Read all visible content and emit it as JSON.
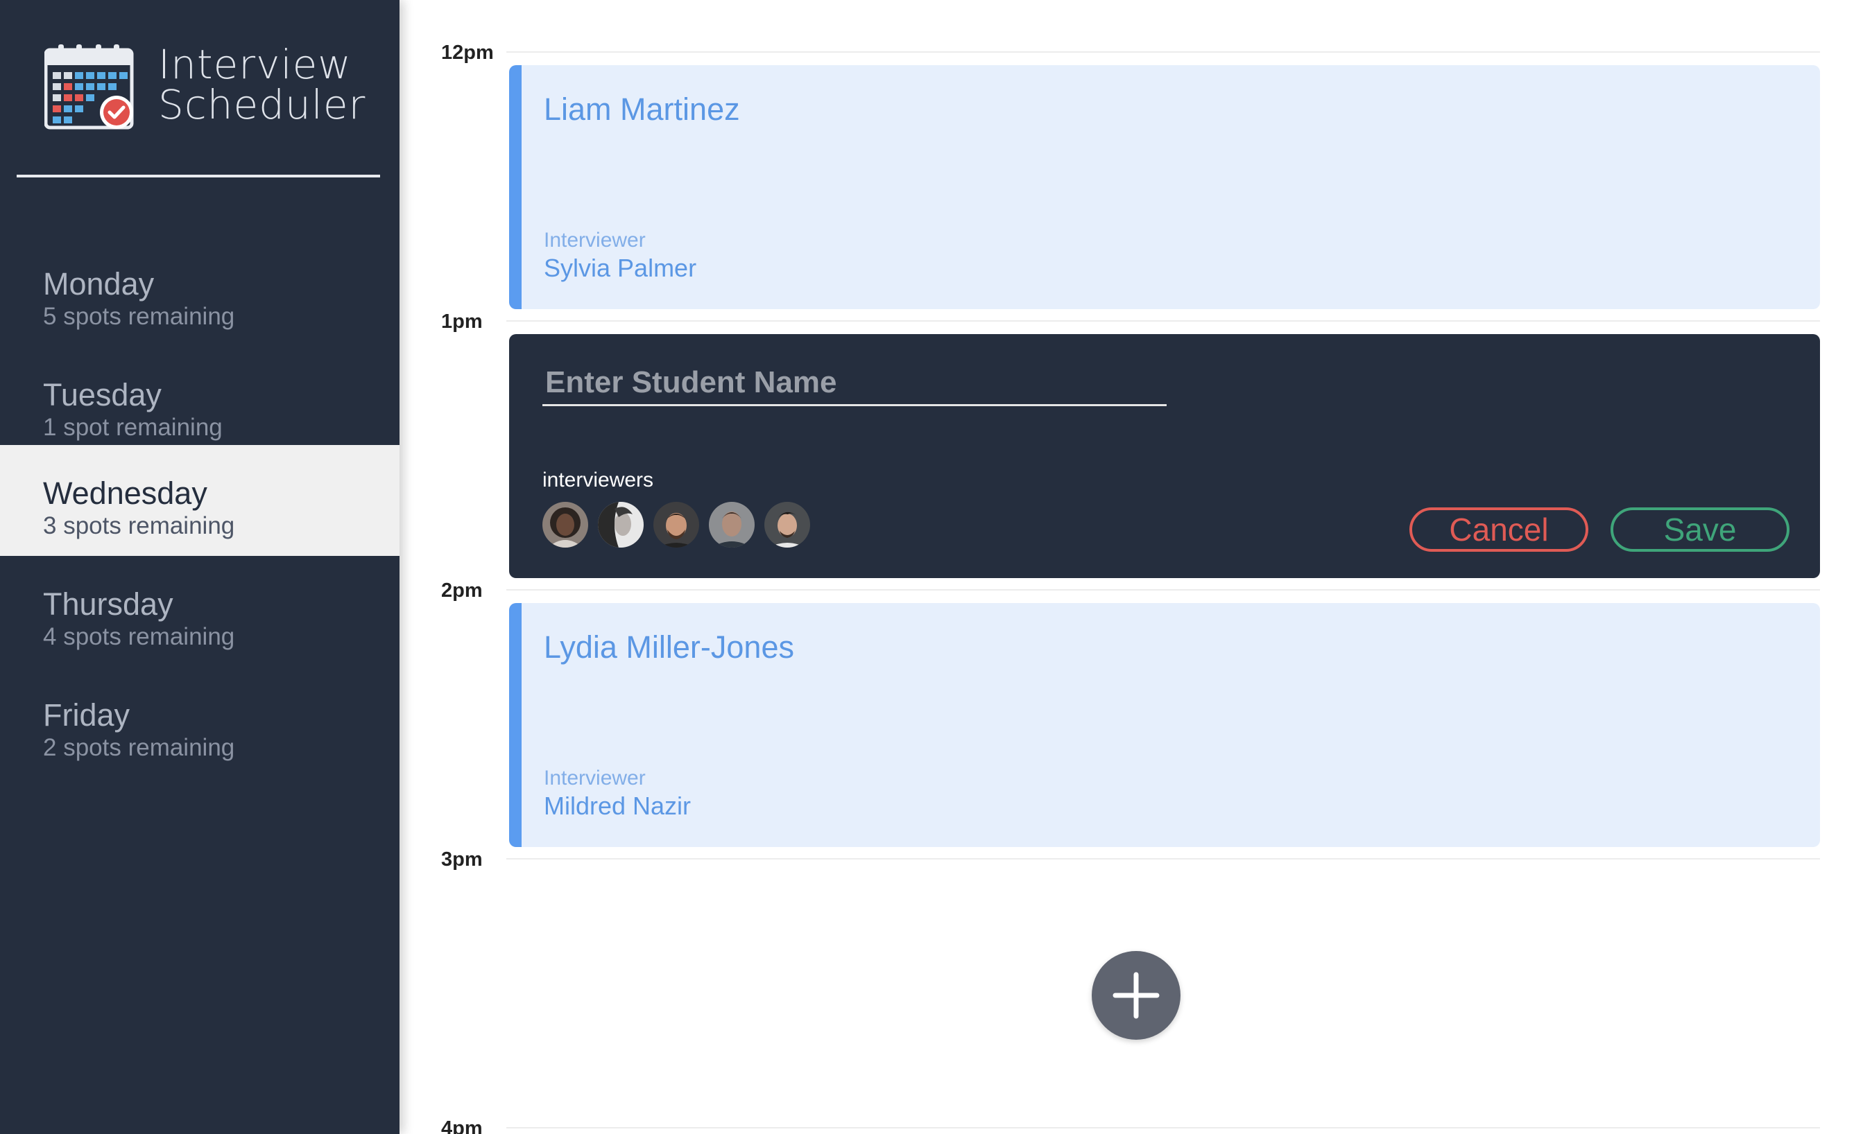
{
  "brand": {
    "line1": "Interview",
    "line2": "Scheduler"
  },
  "days": [
    {
      "name": "Monday",
      "spots": "5 spots remaining",
      "selected": false
    },
    {
      "name": "Tuesday",
      "spots": "1 spot remaining",
      "selected": false
    },
    {
      "name": "Wednesday",
      "spots": "3 spots remaining",
      "selected": true
    },
    {
      "name": "Thursday",
      "spots": "4 spots remaining",
      "selected": false
    },
    {
      "name": "Friday",
      "spots": "2 spots remaining",
      "selected": false
    }
  ],
  "times": [
    "12pm",
    "1pm",
    "2pm",
    "3pm",
    "4pm"
  ],
  "appointments": [
    {
      "student": "Liam Martinez",
      "interviewer_label": "Interviewer",
      "interviewer": "Sylvia Palmer"
    },
    {
      "student": "Lydia Miller-Jones",
      "interviewer_label": "Interviewer",
      "interviewer": "Mildred Nazir"
    }
  ],
  "form": {
    "placeholder": "Enter Student Name",
    "value": "",
    "interviewers_label": "interviewers",
    "interviewer_avatars": [
      "avatar-1",
      "avatar-2",
      "avatar-3",
      "avatar-4",
      "avatar-5"
    ],
    "cancel_label": "Cancel",
    "save_label": "Save"
  },
  "add_button_icon": "plus-icon",
  "colors": {
    "sidebar": "#252e3e",
    "appointment_bg": "#e6effc",
    "appointment_accent": "#5b9cf0",
    "cancel": "#e05b55",
    "save": "#3fa57a"
  }
}
